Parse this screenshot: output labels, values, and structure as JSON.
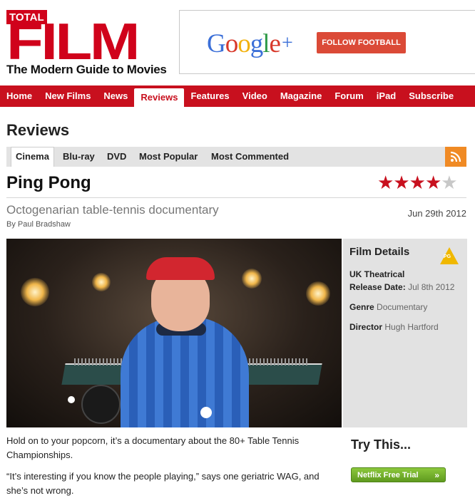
{
  "brand": {
    "logo_top": "TOTAL",
    "logo_main": "FILM",
    "tagline": "The Modern Guide to Movies",
    "color": "#d0021b"
  },
  "ad": {
    "logo_text": "Google",
    "logo_plus": "+",
    "button_label": "FOLLOW FOOTBALL"
  },
  "nav": {
    "items": [
      "Home",
      "New Films",
      "News",
      "Reviews",
      "Features",
      "Video",
      "Magazine",
      "Forum",
      "iPad",
      "Subscribe"
    ],
    "active": "Reviews"
  },
  "section": {
    "title": "Reviews",
    "tabs": [
      "Cinema",
      "Blu-ray",
      "DVD",
      "Most Popular",
      "Most Commented"
    ],
    "active_tab": "Cinema",
    "rss_icon": "rss-icon"
  },
  "article": {
    "title": "Ping Pong",
    "rating": 4,
    "rating_max": 5,
    "subtitle": "Octogenarian table-tennis documentary",
    "date": "Jun 29th 2012",
    "byline": "By Paul Bradshaw",
    "body": [
      "Hold on to your popcorn, it’s a documentary about the 80+ Table Tennis Championships.",
      "“It’s interesting if you know the people playing,” says one geriatric WAG, and she’s not wrong."
    ]
  },
  "film_details": {
    "title": "Film Details",
    "certificate": "PG",
    "uk_theatrical_label": "UK Theatrical",
    "release_label": "Release Date:",
    "release_value": "Jul 8th 2012",
    "genre_label": "Genre",
    "genre_value": "Documentary",
    "director_label": "Director",
    "director_value": "Hugh Hartford"
  },
  "try_this": {
    "title": "Try This...",
    "button_label": "Netflix Free Trial",
    "button_arrow": "»"
  }
}
